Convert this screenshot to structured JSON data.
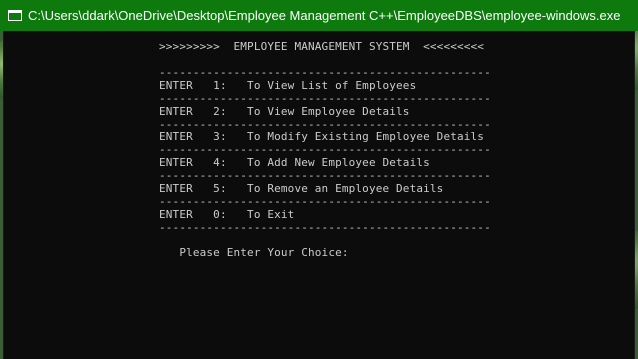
{
  "window": {
    "title": "C:\\Users\\ddark\\OneDrive\\Desktop\\Employee Management C++\\EmployeeDBS\\employee-windows.exe"
  },
  "console": {
    "header": ">>>>>>>>>  EMPLOYEE MANAGEMENT SYSTEM  <<<<<<<<<",
    "divider": "-------------------------------------------------",
    "menu": [
      "ENTER   1:   To View List of Employees",
      "ENTER   2:   To View Employee Details",
      "ENTER   3:   To Modify Existing Employee Details",
      "ENTER   4:   To Add New Employee Details",
      "ENTER   5:   To Remove an Employee Details",
      "ENTER   0:   To Exit"
    ],
    "prompt": "   Please Enter Your Choice:"
  }
}
